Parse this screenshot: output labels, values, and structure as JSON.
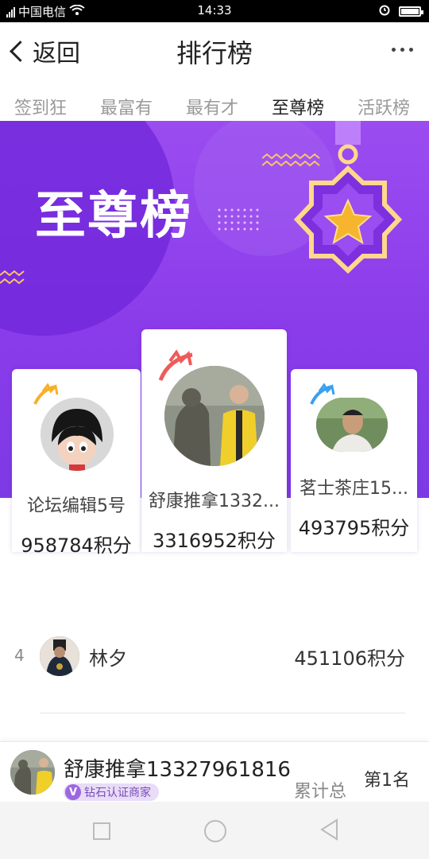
{
  "status_bar": {
    "carrier": "中国电信",
    "time": "14:33",
    "network": "4G"
  },
  "nav": {
    "back_label": "返回",
    "title": "排行榜"
  },
  "tabs": [
    {
      "label": "签到狂"
    },
    {
      "label": "最富有"
    },
    {
      "label": "最有才"
    },
    {
      "label": "至尊榜",
      "active": true
    },
    {
      "label": "活跃榜"
    }
  ],
  "banner": {
    "title": "至尊榜"
  },
  "podium": {
    "first": {
      "name": "舒康推拿1332...",
      "score": "3316952积分"
    },
    "second": {
      "name": "论坛编辑5号",
      "score": "958784积分"
    },
    "third": {
      "name": "茗士茶庄15...",
      "score": "493795积分"
    }
  },
  "ranking": [
    {
      "rank": "4",
      "name": "林夕",
      "score": "451106积分"
    }
  ],
  "me": {
    "name": "舒康推拿13327961816",
    "badge": "钻石认证商家",
    "label": "累计总",
    "rank": "第1名"
  },
  "colors": {
    "banner": "#8a3cea",
    "crown_gold": "#f7b02a",
    "crown_red": "#ef5a5a",
    "crown_blue": "#3aa0f0",
    "star": "#f5b52e"
  }
}
